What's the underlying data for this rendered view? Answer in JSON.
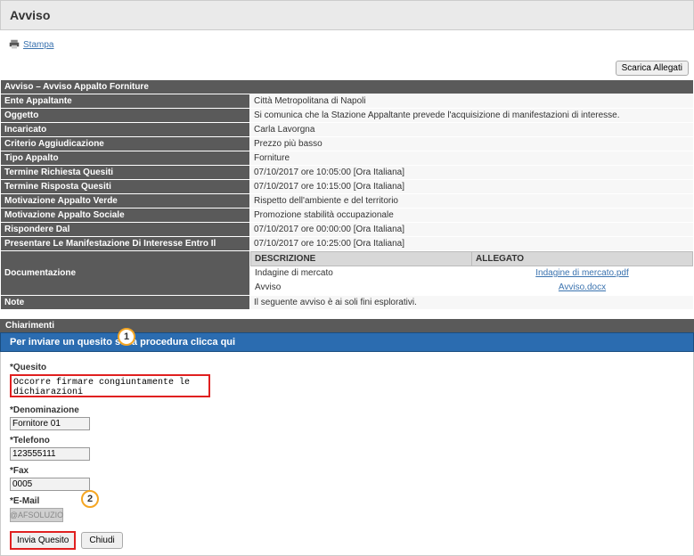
{
  "header": {
    "title": "Avviso"
  },
  "topbar": {
    "stampa": "Stampa",
    "scarica": "Scarica Allegati"
  },
  "details": {
    "row0_label": "Avviso – Avviso Appalto Forniture",
    "rows": [
      {
        "label": "Ente Appaltante",
        "value": "Città Metropolitana di Napoli"
      },
      {
        "label": "Oggetto",
        "value": "Si comunica che la Stazione Appaltante prevede l'acquisizione di manifestazioni di interesse."
      },
      {
        "label": "Incaricato",
        "value": "Carla Lavorgna"
      },
      {
        "label": "Criterio Aggiudicazione",
        "value": "Prezzo più basso"
      },
      {
        "label": "Tipo Appalto",
        "value": "Forniture"
      },
      {
        "label": "Termine Richiesta Quesiti",
        "value": "07/10/2017 ore 10:05:00 [Ora Italiana]"
      },
      {
        "label": "Termine Risposta Quesiti",
        "value": "07/10/2017 ore 10:15:00 [Ora Italiana]"
      },
      {
        "label": "Motivazione Appalto Verde",
        "value": "Rispetto dell'ambiente e del territorio"
      },
      {
        "label": "Motivazione Appalto Sociale",
        "value": "Promozione stabilità occupazionale"
      },
      {
        "label": "Rispondere Dal",
        "value": "07/10/2017 ore 00:00:00 [Ora Italiana]"
      },
      {
        "label": "Presentare Le Manifestazione Di Interesse Entro Il",
        "value": "07/10/2017 ore 10:25:00 [Ora Italiana]"
      }
    ],
    "documentazione_label": "Documentazione",
    "doc_table": {
      "col1": "DESCRIZIONE",
      "col2": "ALLEGATO",
      "rows": [
        {
          "desc": "Indagine di mercato",
          "link": "Indagine di mercato.pdf"
        },
        {
          "desc": "Avviso",
          "link": "Avviso.docx"
        }
      ]
    },
    "note_label": "Note",
    "note_value": "Il seguente avviso è ai soli fini esplorativi."
  },
  "chiarimenti": {
    "header": "Chiarimenti",
    "bluebar": "Per inviare un quesito sulla procedura clicca qui",
    "marker1": "1",
    "quesito_label": "*Quesito",
    "quesito_value": "Occorre firmare congiuntamente le dichiarazioni",
    "denom_label": "*Denominazione",
    "denom_value": "Fornitore 01",
    "tel_label": "*Telefono",
    "tel_value": "123555111",
    "fax_label": "*Fax",
    "fax_value": "0005",
    "email_label": "*E-Mail",
    "email_mask": "@AFSOLUZIO",
    "marker2": "2",
    "invia": "Invia Quesito",
    "chiudi": "Chiudi"
  }
}
